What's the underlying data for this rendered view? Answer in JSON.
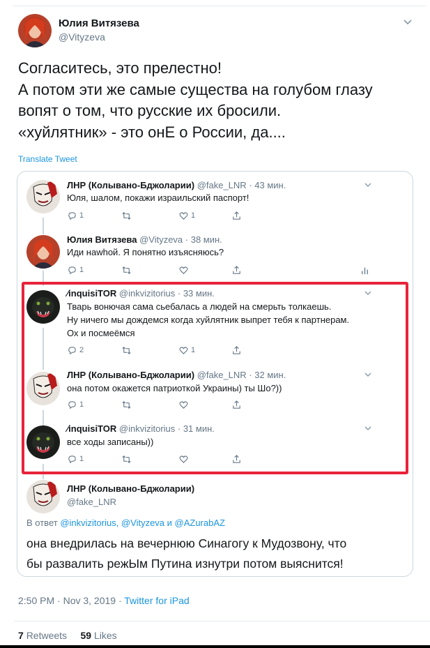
{
  "main": {
    "author_name": "Юлия Витязева",
    "author_handle": "@Vityzeva",
    "text_lines": [
      "Согласитесь, это прелестно!",
      "А потом эти же самые существа на голубом глазу",
      "вопят о том, что русские их бросили.",
      "«хуйлятник» - это онЕ о России, да...."
    ],
    "translate_label": "Translate Tweet",
    "timestamp": "2:50 PM · Nov 3, 2019 ·",
    "source": "Twitter for iPad",
    "retweets_count": "7",
    "retweets_label": "Retweets",
    "likes_count": "59",
    "likes_label": "Likes"
  },
  "quoted": [
    {
      "name": "ЛНР (Колывано-Бджоларии)",
      "meta": "@fake_LNR · 43 мин.",
      "lines": [
        "Юля, шалом, покажи израильский паспорт!"
      ],
      "replies": "1",
      "retweets": "",
      "likes": "1"
    },
    {
      "name": "Юлия Витязева",
      "meta": "@Vityzeva · 38 мин.",
      "lines": [
        "Иди наwhoй. Я понятно изъясняюсь?"
      ],
      "replies": "1",
      "retweets": "",
      "likes": ""
    },
    {
      "name": "⁄inquisiTOR",
      "meta": "@inkvizitorius · 33 мин.",
      "lines": [
        "Тварь вонючая сама сьебалась а людей на смерьть толкаешь.",
        "Ну ничего мы дождемся когда хуйлятник выпрет тебя к партнерам.",
        "Ох и посмеёмся"
      ],
      "replies": "2",
      "retweets": "",
      "likes": "1"
    },
    {
      "name": "ЛНР (Колывано-Бджоларии)",
      "meta": "@fake_LNR · 32 мин.",
      "lines": [
        "она потом окажется патриоткой Украины) ты Шо?))"
      ],
      "replies": "1",
      "retweets": "",
      "likes": ""
    },
    {
      "name": "⁄inquisiTOR",
      "meta": "@inkvizitorius · 31 мин.",
      "lines": [
        "все ходы записаны))"
      ],
      "replies": "1",
      "retweets": "",
      "likes": ""
    }
  ],
  "last_reply": {
    "name": "ЛНР (Колывано-Бджоларии)",
    "handle": "@fake_LNR",
    "reply_prefix": "В ответ",
    "reply_to": "@inkvizitorius, @Vityzeva и @AZurabAZ",
    "lines": [
      "она внедрилась на вечернюю Синагогу к Мудозвону, что",
      "бы развалить режЫм Путина изнутри потом выяснится!"
    ]
  },
  "colors": {
    "accent": "#1b95e0",
    "muted": "#657786",
    "highlight_border": "#e8233a"
  },
  "icons": [
    "chevron-down-icon",
    "reply-icon",
    "retweet-icon",
    "like-icon",
    "share-icon",
    "analytics-icon"
  ]
}
